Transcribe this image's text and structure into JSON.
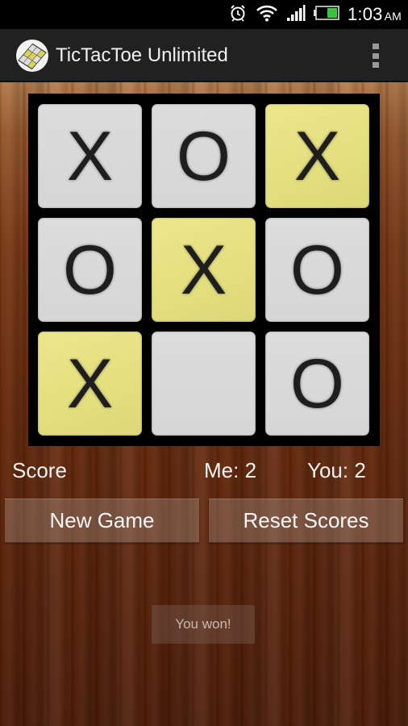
{
  "status_bar": {
    "icons": [
      "alarm-icon",
      "wifi-icon",
      "signal-icon",
      "battery-icon"
    ],
    "time": "1:03",
    "ampm": "AM",
    "battery_color": "#3cc43c"
  },
  "action_bar": {
    "title": "TicTacToe Unlimited",
    "app_icon": "tictactoe-board-icon",
    "overflow_icon": "overflow-menu-icon"
  },
  "board": {
    "cells": [
      {
        "mark": "X",
        "winning": false
      },
      {
        "mark": "O",
        "winning": false
      },
      {
        "mark": "X",
        "winning": true
      },
      {
        "mark": "O",
        "winning": false
      },
      {
        "mark": "X",
        "winning": true
      },
      {
        "mark": "O",
        "winning": false
      },
      {
        "mark": "X",
        "winning": true
      },
      {
        "mark": "",
        "winning": false
      },
      {
        "mark": "O",
        "winning": false
      }
    ],
    "cell_color": "#d9d9d9",
    "win_color": "#e6e283"
  },
  "score": {
    "label": "Score",
    "me": "Me: 2",
    "you": "You: 2"
  },
  "buttons": {
    "new_game": "New Game",
    "reset_scores": "Reset Scores"
  },
  "toast": {
    "message": "You won!"
  }
}
